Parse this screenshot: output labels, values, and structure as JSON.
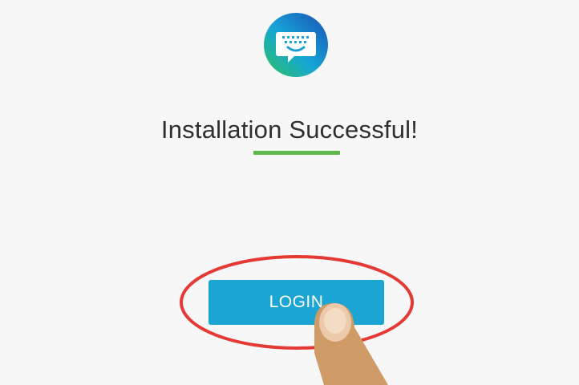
{
  "app": {
    "icon_name": "keyboard-chat-icon"
  },
  "heading": {
    "title": "Installation Successful!"
  },
  "actions": {
    "login_label": "LOGIN"
  },
  "colors": {
    "accent": "#1ba5d4",
    "underline": "#5db84c",
    "highlight": "#e53935",
    "text": "#2f2f2f",
    "background": "#f7f7f7"
  }
}
